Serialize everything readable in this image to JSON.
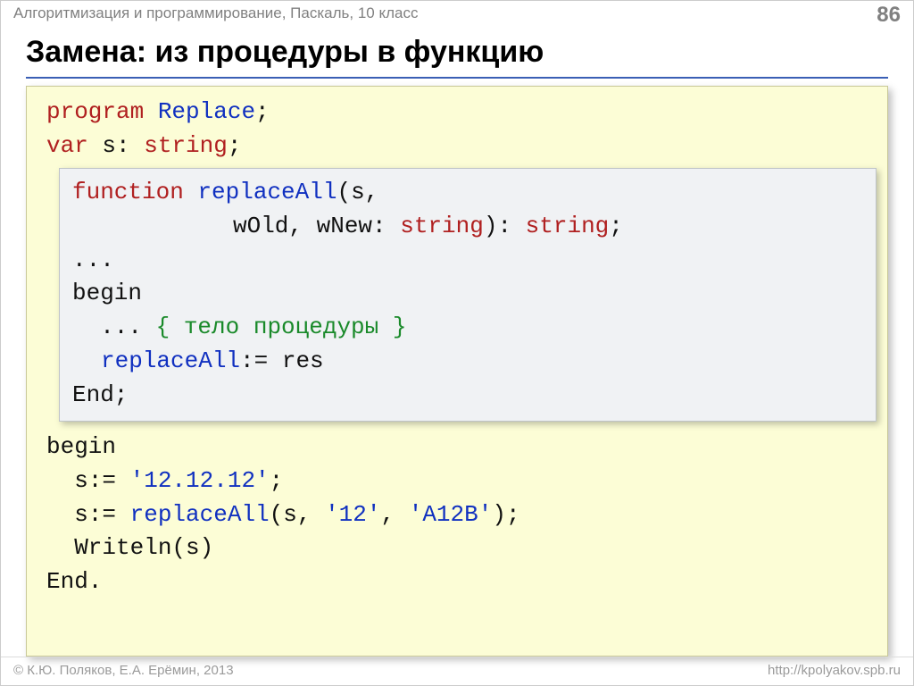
{
  "header": {
    "breadcrumb": "Алгоритмизация и программирование, Паскаль, 10 класс",
    "page": "86"
  },
  "title": "Замена: из процедуры в функцию",
  "outer": {
    "l1_a": "program",
    "l1_b": "Replace",
    "l1_c": ";",
    "l2_a": "var",
    "l2_b": " s: ",
    "l2_c": "string",
    "l2_d": ";",
    "l3": "begin",
    "l4_a": "  s:= ",
    "l4_b": "'12.12.12'",
    "l4_c": ";",
    "l5_a": "  s:= ",
    "l5_b": "replaceAll",
    "l5_c": "(s, ",
    "l5_d": "'12'",
    "l5_e": ", ",
    "l5_f": "'A12B'",
    "l5_g": ");",
    "l6": "  Writeln(s)",
    "l7": "End."
  },
  "inner": {
    "l1_a": "function",
    "l1_b": "replaceAll",
    "l1_c": "(s,",
    "l2_a": "wOld, wNew: ",
    "l2_b": "string",
    "l2_c": "): ",
    "l2_d": "string",
    "l2_e": ";",
    "l3": "...",
    "l4": "begin",
    "l5_a": "  ... ",
    "l5_b": "{ тело процедуры }",
    "l6_a": "replaceAll",
    "l6_b": ":= res",
    "l7": "End;"
  },
  "footer": {
    "left": "© К.Ю. Поляков, Е.А. Ерёмин, 2013",
    "right": "http://kpolyakov.spb.ru"
  }
}
